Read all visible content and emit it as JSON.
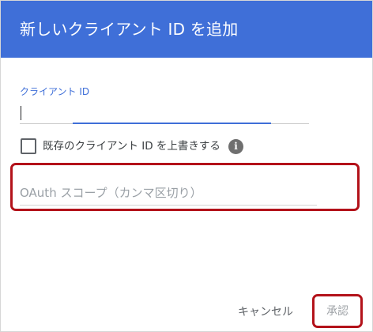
{
  "dialog": {
    "title": "新しいクライアント ID を追加",
    "header_color": "#3f6fd8"
  },
  "client_id": {
    "label": "クライアント ID",
    "value": ""
  },
  "overwrite": {
    "label": "既存のクライアント ID を上書きする",
    "checked": false,
    "info_icon": "info-icon",
    "info_glyph": "i"
  },
  "scope": {
    "placeholder": "OAuth スコープ（カンマ区切り）",
    "value": ""
  },
  "actions": {
    "cancel_label": "キャンセル",
    "approve_label": "承認",
    "approve_enabled": false
  },
  "highlight_color": "#b3121a"
}
